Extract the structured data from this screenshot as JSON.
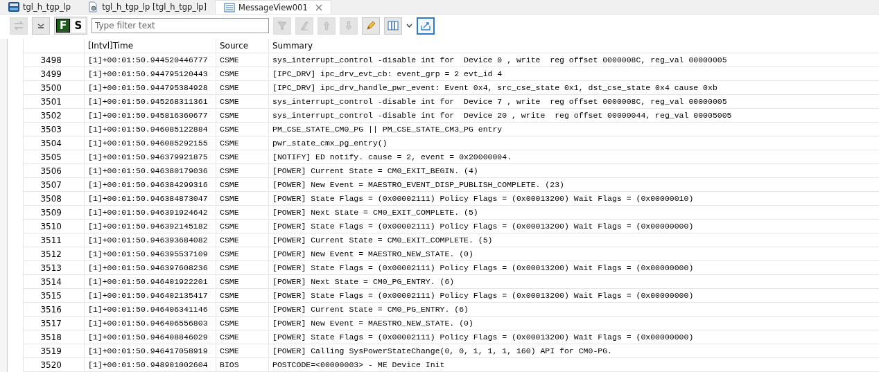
{
  "tabs": [
    {
      "label": "tgl_h_tgp_lp",
      "kind": "debug",
      "selected": false,
      "closable": false
    },
    {
      "label": "tgl_h_tgp_lp [tgl_h_tgp_lp]",
      "kind": "document",
      "selected": false,
      "closable": false
    },
    {
      "label": "MessageView001",
      "kind": "list",
      "selected": true,
      "closable": true
    }
  ],
  "toolbar": {
    "left_buttons": [
      {
        "kind": "swap",
        "disabled": true
      },
      {
        "kind": "collapse",
        "disabled": false
      }
    ],
    "toggles": [
      {
        "label": "F",
        "selected": true
      },
      {
        "label": "S",
        "selected": false
      }
    ],
    "filter": {
      "placeholder": "Type filter text"
    },
    "right_buttons": [
      {
        "kind": "funnel",
        "disabled": true
      },
      {
        "kind": "eraser",
        "disabled": true
      },
      {
        "kind": "up",
        "disabled": true
      },
      {
        "kind": "down",
        "disabled": true
      },
      {
        "kind": "pen",
        "disabled": false
      },
      {
        "kind": "columns",
        "disabled": false,
        "dropdown": true
      },
      {
        "kind": "export",
        "disabled": false,
        "selected": true
      }
    ]
  },
  "table": {
    "columns": [
      "[Intvl]Time",
      "Source",
      "Summary"
    ],
    "rows": [
      {
        "index": "3498",
        "time": "[1]+00:01:50.944520446777",
        "source": "CSME",
        "summary": "sys_interrupt_control -disable int for  Device 0 , write  reg offset 0000008C, reg_val 00000005"
      },
      {
        "index": "3499",
        "time": "[1]+00:01:50.944795120443",
        "source": "CSME",
        "summary": "[IPC_DRV] ipc_drv_evt_cb: event_grp = 2 evt_id 4"
      },
      {
        "index": "3500",
        "time": "[1]+00:01:50.944795384928",
        "source": "CSME",
        "summary": "[IPC_DRV] ipc_drv_handle_pwr_event: Event 0x4, src_cse_state 0x1, dst_cse_state 0x4 cause 0xb"
      },
      {
        "index": "3501",
        "time": "[1]+00:01:50.945268311361",
        "source": "CSME",
        "summary": "sys_interrupt_control -disable int for  Device 7 , write  reg offset 0000008C, reg_val 00000005"
      },
      {
        "index": "3502",
        "time": "[1]+00:01:50.945816360677",
        "source": "CSME",
        "summary": "sys_interrupt_control -disable int for  Device 20 , write  reg offset 00000044, reg_val 00005005"
      },
      {
        "index": "3503",
        "time": "[1]+00:01:50.946085122884",
        "source": "CSME",
        "summary": "PM_CSE_STATE_CM0_PG || PM_CSE_STATE_CM3_PG entry"
      },
      {
        "index": "3504",
        "time": "[1]+00:01:50.946085292155",
        "source": "CSME",
        "summary": "pwr_state_cmx_pg_entry()"
      },
      {
        "index": "3505",
        "time": "[1]+00:01:50.946379921875",
        "source": "CSME",
        "summary": "[NOTIFY] ED notify. cause = 2, event = 0x20000004."
      },
      {
        "index": "3506",
        "time": "[1]+00:01:50.946380179036",
        "source": "CSME",
        "summary": "[POWER] Current State = CM0_EXIT_BEGIN. (4)"
      },
      {
        "index": "3507",
        "time": "[1]+00:01:50.946384299316",
        "source": "CSME",
        "summary": "[POWER] New Event = MAESTRO_EVENT_DISP_PUBLISH_COMPLETE. (23)"
      },
      {
        "index": "3508",
        "time": "[1]+00:01:50.946384873047",
        "source": "CSME",
        "summary": "[POWER] State Flags = (0x00002111) Policy Flags = (0x00013200) Wait Flags = (0x00000010)"
      },
      {
        "index": "3509",
        "time": "[1]+00:01:50.946391924642",
        "source": "CSME",
        "summary": "[POWER] Next State = CM0_EXIT_COMPLETE. (5)"
      },
      {
        "index": "3510",
        "time": "[1]+00:01:50.946392145182",
        "source": "CSME",
        "summary": "[POWER] State Flags = (0x00002111) Policy Flags = (0x00013200) Wait Flags = (0x00000000)"
      },
      {
        "index": "3511",
        "time": "[1]+00:01:50.946393684082",
        "source": "CSME",
        "summary": "[POWER] Current State = CM0_EXIT_COMPLETE. (5)"
      },
      {
        "index": "3512",
        "time": "[1]+00:01:50.946395537109",
        "source": "CSME",
        "summary": "[POWER] New Event = MAESTRO_NEW_STATE. (0)"
      },
      {
        "index": "3513",
        "time": "[1]+00:01:50.946397608236",
        "source": "CSME",
        "summary": "[POWER] State Flags = (0x00002111) Policy Flags = (0x00013200) Wait Flags = (0x00000000)"
      },
      {
        "index": "3514",
        "time": "[1]+00:01:50.946401922201",
        "source": "CSME",
        "summary": "[POWER] Next State = CM0_PG_ENTRY. (6)"
      },
      {
        "index": "3515",
        "time": "[1]+00:01:50.946402135417",
        "source": "CSME",
        "summary": "[POWER] State Flags = (0x00002111) Policy Flags = (0x00013200) Wait Flags = (0x00000000)"
      },
      {
        "index": "3516",
        "time": "[1]+00:01:50.946406341146",
        "source": "CSME",
        "summary": "[POWER] Current State = CM0_PG_ENTRY. (6)"
      },
      {
        "index": "3517",
        "time": "[1]+00:01:50.946406556803",
        "source": "CSME",
        "summary": "[POWER] New Event = MAESTRO_NEW_STATE. (0)"
      },
      {
        "index": "3518",
        "time": "[1]+00:01:50.946408846029",
        "source": "CSME",
        "summary": "[POWER] State Flags = (0x00002111) Policy Flags = (0x00013200) Wait Flags = (0x00000000)"
      },
      {
        "index": "3519",
        "time": "[1]+00:01:50.946417058919",
        "source": "CSME",
        "summary": "[POWER] Calling SysPowerStateChange(0, 0, 1, 1, 1, 160) API for CM0-PG."
      },
      {
        "index": "3520",
        "time": "[1]+00:01:50.948901002604",
        "source": "BIOS",
        "summary": "POSTCODE=<00000003> - ME Device Init"
      }
    ]
  }
}
